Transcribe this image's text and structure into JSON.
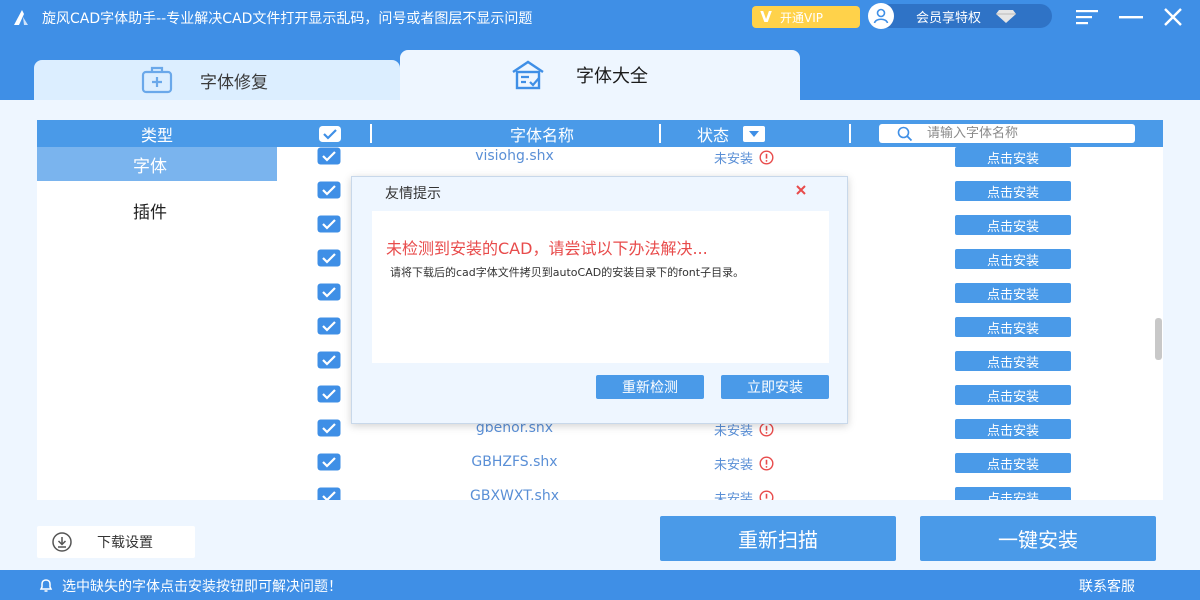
{
  "titlebar": {
    "title": "旋风CAD字体助手--专业解决CAD文件打开显示乱码，问号或者图层不显示问题",
    "vip_label": "开通VIP",
    "member_label": "会员享特权"
  },
  "tabs": [
    {
      "label": "字体修复",
      "active": false
    },
    {
      "label": "字体大全",
      "active": true
    }
  ],
  "table": {
    "col_type": "类型",
    "col_name": "字体名称",
    "col_status": "状态",
    "search_placeholder": "请输入字体名称"
  },
  "sidebar": {
    "items": [
      {
        "label": "字体",
        "active": true
      },
      {
        "label": "插件",
        "active": false
      }
    ]
  },
  "rows": [
    {
      "name": "visiohg.shx",
      "status": "未安装",
      "action": "点击安装"
    },
    {
      "name": "",
      "status": "",
      "action": "点击安装"
    },
    {
      "name": "",
      "status": "",
      "action": "点击安装"
    },
    {
      "name": "",
      "status": "",
      "action": "点击安装"
    },
    {
      "name": "",
      "status": "",
      "action": "点击安装"
    },
    {
      "name": "",
      "status": "",
      "action": "点击安装"
    },
    {
      "name": "",
      "status": "",
      "action": "点击安装"
    },
    {
      "name": "",
      "status": "",
      "action": "点击安装"
    },
    {
      "name": "gbenor.shx",
      "status": "未安装",
      "action": "点击安装"
    },
    {
      "name": "GBHZFS.shx",
      "status": "未安装",
      "action": "点击安装"
    },
    {
      "name": "GBXWXT.shx",
      "status": "未安装",
      "action": "点击安装"
    }
  ],
  "dialog": {
    "title": "友情提示",
    "warning": "未检测到安装的CAD，请尝试以下办法解决...",
    "text": "请将下载后的cad字体文件拷贝到autoCAD的安装目录下的font子目录。",
    "recheck_label": "重新检测",
    "install_label": "立即安装"
  },
  "bottom": {
    "download_settings": "下载设置",
    "rescan": "重新扫描",
    "install_all": "一键安装"
  },
  "footer": {
    "tip": "选中缺失的字体点击安装按钮即可解决问题！",
    "contact": "联系客服"
  },
  "colors": {
    "brand": "#3f8fe6",
    "accent": "#4a9ae8",
    "warning": "#e84b4b",
    "vip": "#ffd24a"
  }
}
